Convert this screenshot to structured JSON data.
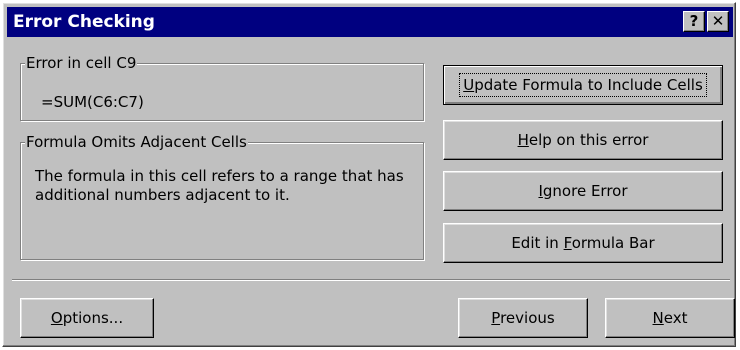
{
  "window": {
    "title": "Error Checking",
    "help_glyph": "?",
    "close_glyph": "✕"
  },
  "error_group": {
    "legend": "Error in cell C9",
    "formula": "=SUM(C6:C7)"
  },
  "description_group": {
    "legend": "Formula Omits Adjacent Cells",
    "text": "The formula in this cell refers to a range that has additional numbers adjacent to it."
  },
  "buttons": {
    "update": {
      "mnemonic": "U",
      "rest": "pdate Formula to Include Cells"
    },
    "help": {
      "mnemonic": "H",
      "rest": "elp on this error"
    },
    "ignore": {
      "mnemonic": "I",
      "rest": "gnore Error"
    },
    "edit": {
      "pre": "Edit in ",
      "mnemonic": "F",
      "rest": "ormula Bar"
    },
    "options": {
      "mnemonic": "O",
      "rest": "ptions..."
    },
    "previous": {
      "mnemonic": "P",
      "rest": "revious"
    },
    "next": {
      "mnemonic": "N",
      "rest": "ext"
    }
  }
}
